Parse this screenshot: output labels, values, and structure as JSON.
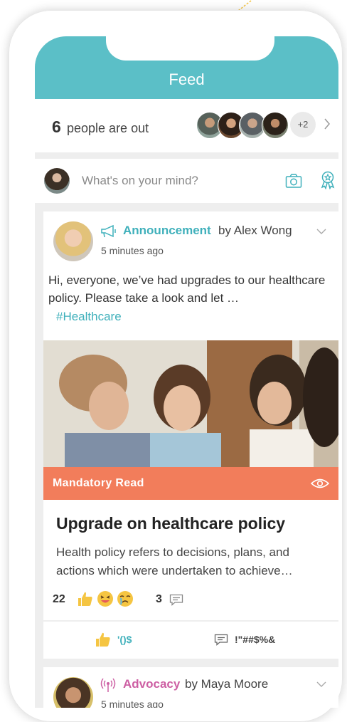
{
  "header": {
    "title": "Feed"
  },
  "out": {
    "count": "6",
    "label": "people are out",
    "extra": "+2"
  },
  "composer": {
    "placeholder": "What's on your mind?"
  },
  "post": {
    "type": "Announcement",
    "author": "by Alex Wong",
    "time": "5 minutes ago",
    "body": "Hi, everyone, we’ve had upgrades to our healthcare policy. Please take a look and let …",
    "tag": "#Healthcare",
    "banner": "Mandatory Read",
    "article_title": "Upgrade on healthcare policy",
    "article_summary": "Health policy refers to decisions, plans, and actions which were undertaken to achieve…",
    "reaction_count": "22",
    "comment_count": "3"
  },
  "actions": {
    "like_label": "'()$",
    "comment_label": "!\"##$%&"
  },
  "post2": {
    "type": "Advocacy",
    "author": "by Maya Moore",
    "time": "5 minutes ago"
  },
  "colors": {
    "teal": "#5bbfc7",
    "accent_teal": "#3fb0bb",
    "banner": "#f27d5b",
    "advocacy": "#cd5fa3"
  },
  "icons": [
    "camera-icon",
    "award-icon",
    "megaphone-icon",
    "eye-icon",
    "like-icon",
    "comment-icon",
    "broadcast-icon",
    "chevron-right-icon",
    "chevron-down-icon"
  ]
}
